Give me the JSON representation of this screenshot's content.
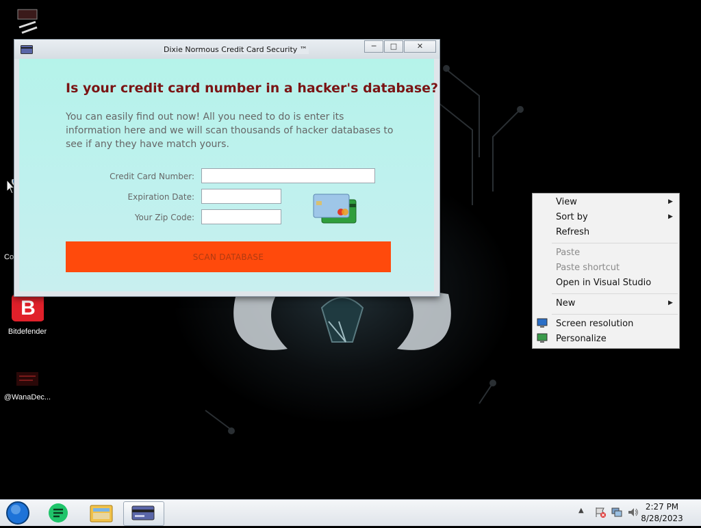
{
  "window": {
    "title": "Dixie Normous Credit Card Security ™",
    "headline": "Is your credit card number in a hacker's database?",
    "description": "You can easily find out now! All you need to do is enter its information here and we will scan thousands of hacker databases to see if any they have match yours.",
    "fields": {
      "card_number_label": "Credit Card Number:",
      "card_number_value": "",
      "expiration_label": "Expiration Date:",
      "expiration_value": "",
      "zip_label": "Your Zip Code:",
      "zip_value": ""
    },
    "scan_button": "SCAN DATABASE"
  },
  "desktop_icons": [
    {
      "label": "Co"
    },
    {
      "label": "Bitdefender"
    },
    {
      "label": "@WanaDec..."
    }
  ],
  "context_menu": {
    "items": [
      {
        "label": "View",
        "submenu": true,
        "enabled": true
      },
      {
        "label": "Sort by",
        "submenu": true,
        "enabled": true
      },
      {
        "label": "Refresh",
        "submenu": false,
        "enabled": true
      },
      {
        "label": "Paste",
        "submenu": false,
        "enabled": false
      },
      {
        "label": "Paste shortcut",
        "submenu": false,
        "enabled": false
      },
      {
        "label": "Open in Visual Studio",
        "submenu": false,
        "enabled": true
      },
      {
        "label": "New",
        "submenu": true,
        "enabled": true
      },
      {
        "label": "Screen resolution",
        "submenu": false,
        "enabled": true
      },
      {
        "label": "Personalize",
        "submenu": false,
        "enabled": true
      }
    ]
  },
  "taskbar": {
    "time": "2:27 PM",
    "date": "8/28/2023"
  },
  "colors": {
    "scan_button": "#ff4a0c",
    "headline": "#7a1414",
    "client_bg": "#b5f3ea"
  }
}
